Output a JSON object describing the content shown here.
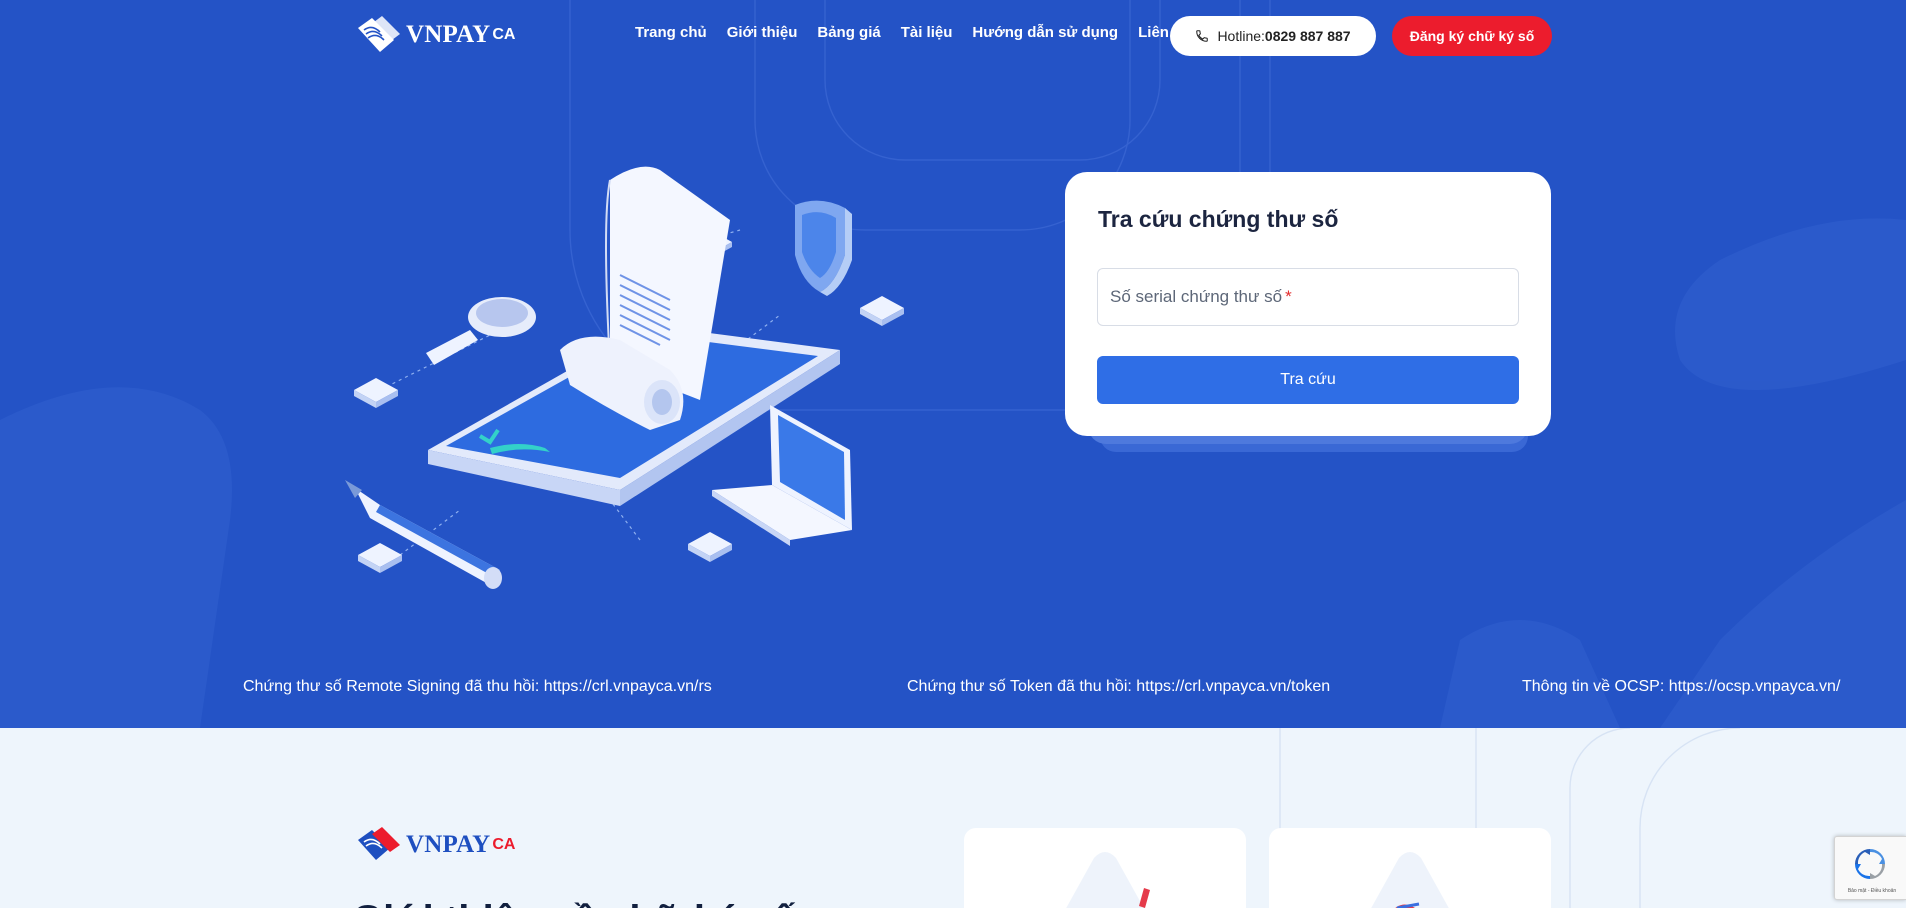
{
  "header": {
    "logo_text": "VNPAY",
    "logo_suffix": "CA",
    "nav": [
      {
        "label": "Trang chủ"
      },
      {
        "label": "Giới thiệu"
      },
      {
        "label": "Bảng giá"
      },
      {
        "label": "Tài liệu"
      },
      {
        "label": "Hướng dẫn sử dụng"
      },
      {
        "label": "Liên hệ"
      }
    ],
    "hotline_label": "Hotline:",
    "hotline_number": "0829 887 887",
    "register_label": "Đăng ký chữ ký số"
  },
  "lookup": {
    "title": "Tra cứu chứng thư số",
    "field_placeholder": "Số serial chứng thư số",
    "required_mark": "*",
    "button_label": "Tra cứu"
  },
  "links": {
    "remote_signing": "Chứng thư số Remote Signing đã thu hồi: https://crl.vnpayca.vn/rs",
    "token": "Chứng thư số Token đã thu hồi: https://crl.vnpayca.vn/token",
    "ocsp": "Thông tin về OCSP: https://ocsp.vnpayca.vn/"
  },
  "lower": {
    "logo_text": "VNPAY",
    "logo_suffix": "CA",
    "heading": "Giới thiệu về chữ ký số"
  },
  "recaptcha": {
    "footer_text": "Bảo mật - Điều khoản"
  },
  "colors": {
    "hero_bg": "#2453c6",
    "primary_button": "#2f6ee6",
    "register_button": "#ec1c2d",
    "lower_bg": "#eef5fc"
  }
}
